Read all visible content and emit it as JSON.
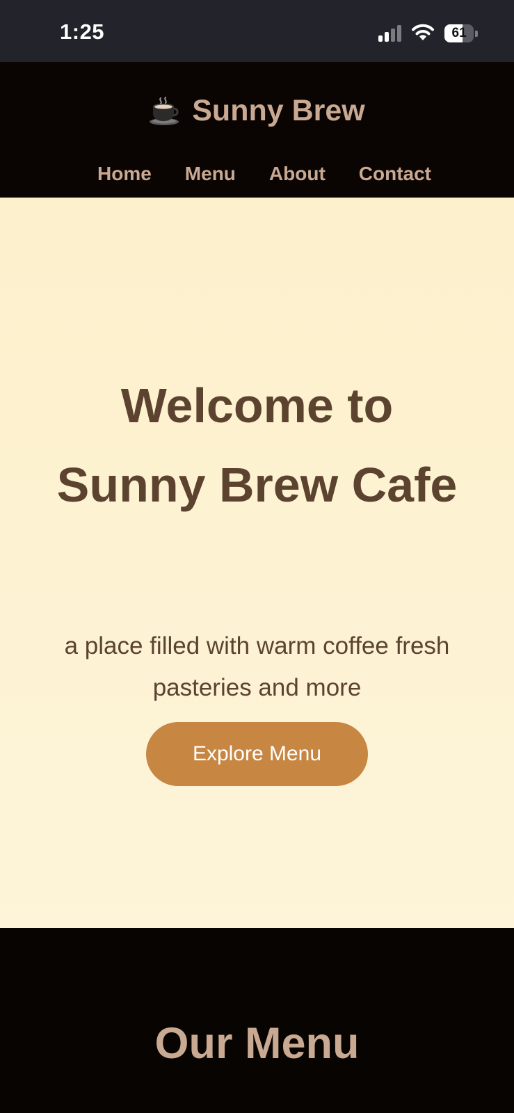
{
  "status_bar": {
    "time": "1:25",
    "signal_bars": 2,
    "signal_bars_total": 4,
    "battery_level": "61",
    "battery_percent": 61,
    "icons": [
      "cellular-signal-icon",
      "wifi-icon",
      "battery-icon"
    ]
  },
  "header": {
    "brand_icon": "coffee-cup-icon",
    "brand_name": "Sunny Brew",
    "nav": [
      {
        "label": "Home"
      },
      {
        "label": "Menu"
      },
      {
        "label": "About"
      },
      {
        "label": "Contact"
      }
    ]
  },
  "hero": {
    "title_line1": "Welcome to",
    "title_line2": "Sunny Brew Cafe",
    "subtitle": "a place filled with warm coffee fresh pasteries and more",
    "cta_label": "Explore Menu"
  },
  "menu_section": {
    "title": "Our Menu"
  },
  "colors": {
    "status_bar_bg": "#23242b",
    "header_bg": "#0a0502",
    "brand_text": "#c9a991",
    "hero_bg": "#fdf1cf",
    "hero_text": "#5c4330",
    "cta_bg": "#c78642",
    "cta_text": "#ffffff",
    "section_bg": "#080402"
  }
}
